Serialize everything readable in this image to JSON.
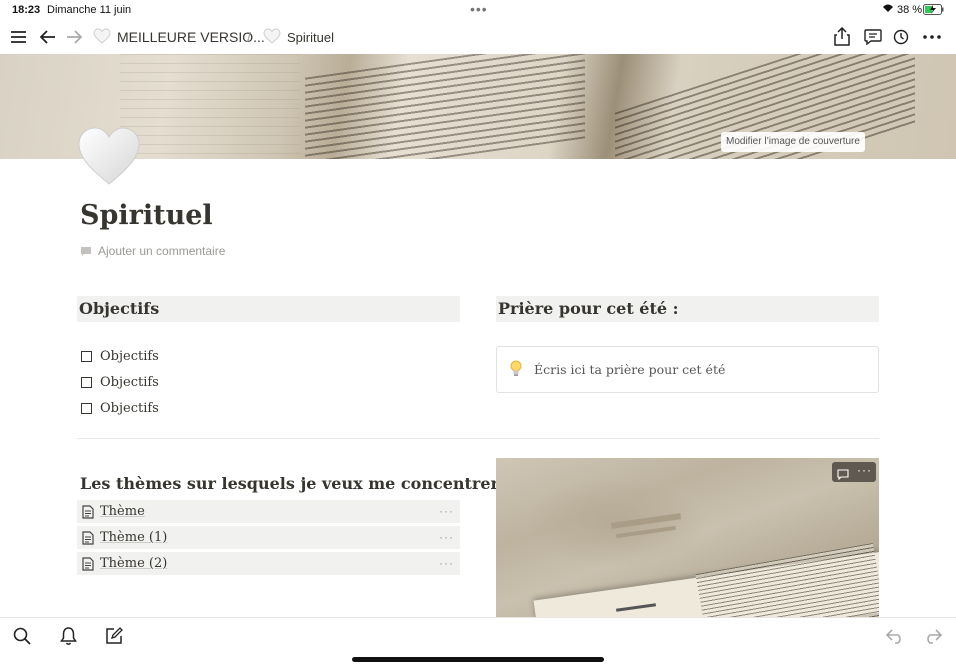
{
  "status_bar": {
    "time": "18:23",
    "date": "Dimanche 11 juin",
    "battery": "38 %"
  },
  "nav": {
    "breadcrumb_parent": "MEILLEURE VERSIO...",
    "separator": "/",
    "breadcrumb_current": "Spirituel"
  },
  "cover": {
    "change_button": "Modifier l’image de couverture"
  },
  "page": {
    "icon": "white-heart-emoji",
    "title": "Spirituel",
    "add_comment": "Ajouter un commentaire"
  },
  "objectifs": {
    "heading": "Objectifs",
    "todos": [
      {
        "label": "Objectifs",
        "checked": false
      },
      {
        "label": "Objectifs",
        "checked": false
      },
      {
        "label": "Objectifs",
        "checked": false
      }
    ]
  },
  "priere": {
    "heading": "Prière pour cet été :",
    "callout_icon": "lightbulb-emoji",
    "callout_text": "Écris ici ta prière pour cet été"
  },
  "themes": {
    "heading": "Les thèmes sur lesquels je veux me concentrer :",
    "pages": [
      "Thème",
      "Thème (1)",
      "Thème (2)"
    ],
    "more_symbol": "···"
  },
  "image_block": {
    "more_symbol": "···"
  },
  "icons": [
    "menu-icon",
    "back-arrow-icon",
    "forward-arrow-icon",
    "share-icon",
    "comments-icon",
    "history-icon",
    "more-icon",
    "search-icon",
    "bell-icon",
    "compose-icon",
    "undo-icon",
    "redo-icon",
    "page-icon",
    "comment-icon",
    "wifi-icon",
    "battery-icon"
  ]
}
